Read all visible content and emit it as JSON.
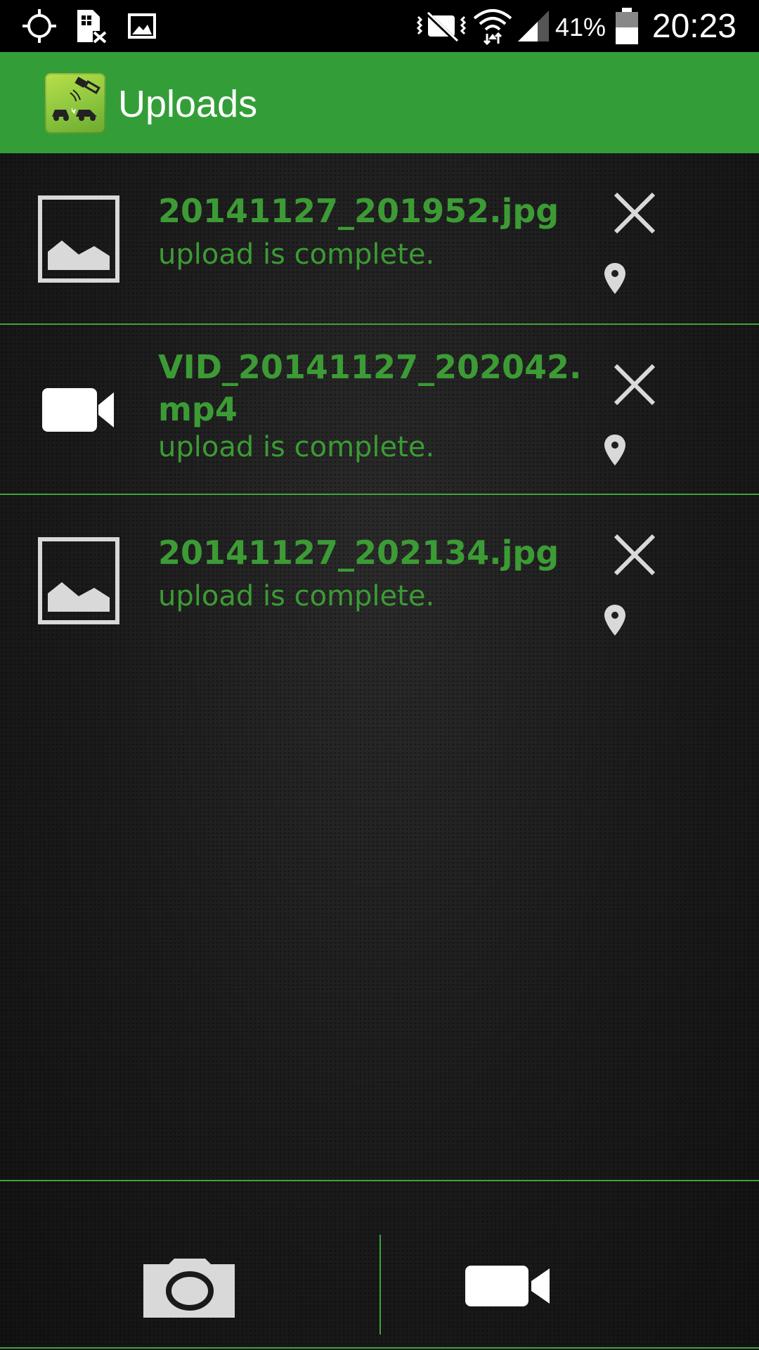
{
  "status_bar": {
    "battery_percent": "41%",
    "time": "20:23",
    "icons": [
      "gps-icon",
      "sim-off-icon",
      "gallery-icon",
      "vibrate-mute-icon",
      "wifi-icon",
      "signal-icon",
      "battery-icon"
    ]
  },
  "action_bar": {
    "title": "Uploads",
    "logo_icon": "app-logo-icon"
  },
  "uploads": [
    {
      "file_name": "20141127_201952.jpg",
      "status": "upload is complete.",
      "type_icon": "image-icon"
    },
    {
      "file_name": "VID_20141127_202042.mp4",
      "status": "upload is complete.",
      "type_icon": "video-icon"
    },
    {
      "file_name": "20141127_202134.jpg",
      "status": "upload is complete.",
      "type_icon": "image-icon"
    }
  ],
  "bottom_bar": {
    "left_button_icon": "camera-icon",
    "right_button_icon": "video-camera-icon"
  },
  "colors": {
    "accent_green": "#339e38",
    "text_green": "#3c9b35",
    "divider_green": "#3ea43a",
    "status_bar_bg": "#000000"
  }
}
